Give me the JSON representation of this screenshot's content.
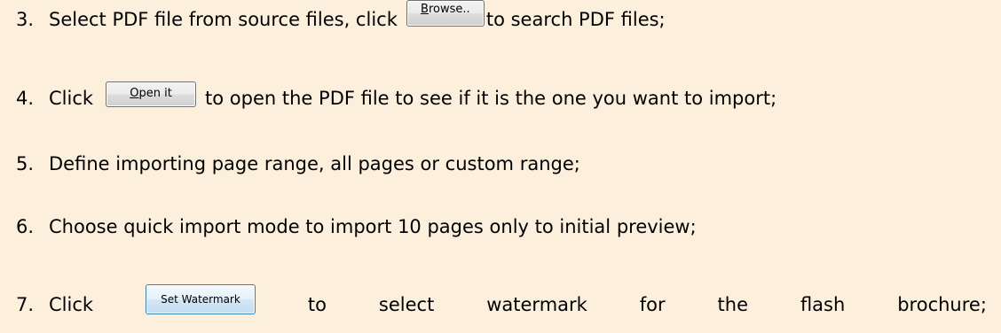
{
  "steps": [
    {
      "number": "3.",
      "before": "Select PDF file from source files, click",
      "after": "to search PDF files;"
    },
    {
      "number": "4.",
      "before": "Click",
      "after": "to open the PDF file to see if it is the one you want to import;"
    },
    {
      "number": "5.",
      "text": "Define importing page range, all pages or custom range;"
    },
    {
      "number": "6.",
      "text": "Choose quick import mode to import 10 pages only to initial preview;"
    },
    {
      "number": "7.",
      "words": [
        "Click",
        "to",
        "select",
        "watermark",
        "for",
        "the",
        "flash",
        "brochure;"
      ]
    }
  ],
  "buttons": {
    "browse": {
      "accel": "B",
      "rest": "rowse.."
    },
    "open_it": {
      "accel": "O",
      "rest": "pen it"
    },
    "set_watermark": {
      "label": "Set Watermark"
    }
  }
}
